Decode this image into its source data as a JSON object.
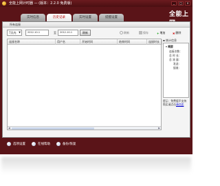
{
  "window": {
    "title": "全能上网计时器 — (版本：2.2.0 免费版)",
    "controls": [
      "_",
      "□",
      "×"
    ]
  },
  "brand": {
    "name": "全能上网",
    "link": "点此"
  },
  "tabs": [
    {
      "label": "实时信息",
      "active": false
    },
    {
      "label": "历史记录",
      "active": true
    },
    {
      "label": "实时设置",
      "active": false
    },
    {
      "label": "提醒设置",
      "active": false
    }
  ],
  "panel": {
    "title": "所有连接",
    "range_select": "7天内",
    "date_from": "2012-10-1",
    "date_to": "2012-10-1",
    "range_separator": "至",
    "query_button": "刷新",
    "tools": [
      {
        "label": "刷新",
        "icon": "refresh-icon",
        "enabled": false
      },
      {
        "label": "保存",
        "icon": "save-icon",
        "enabled": false
      },
      {
        "label": "增加",
        "icon": "plus-icon",
        "enabled": true
      },
      {
        "label": "删除",
        "icon": "delete-icon",
        "enabled": true
      }
    ]
  },
  "grid": {
    "columns": [
      "连接名称",
      "用户名",
      "开始时间",
      "结束时间",
      "连接时长"
    ]
  },
  "stats": {
    "header": "统计信息",
    "title": "概要",
    "lines": [
      "连接次数：",
      "总 时 长：",
      "总 流 量：",
      "发送：",
      "接收："
    ]
  },
  "tip": {
    "line1": "提示：免费版不支持",
    "line2": "购买请点击",
    "link": "请点此"
  },
  "footer": {
    "buttons": [
      {
        "label": "选项设置",
        "icon": "gear-icon"
      },
      {
        "label": "在线帮助",
        "icon": "help-icon"
      },
      {
        "label": "备份/恢复",
        "icon": "backup-icon"
      }
    ]
  },
  "colors": {
    "frame": "#5a1418",
    "accent": "#b00000"
  }
}
